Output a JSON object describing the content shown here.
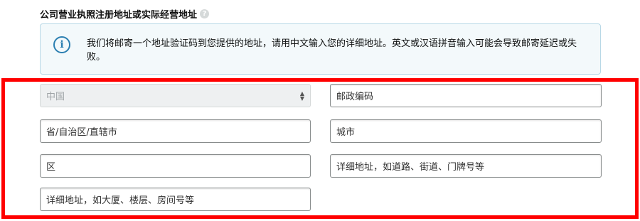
{
  "section": {
    "title": "公司营业执照注册地址或实际经营地址",
    "help_icon": "question-circle-icon"
  },
  "info": {
    "icon": "info-circle-icon",
    "icon_glyph": "i",
    "message": "我们将邮寄一个地址验证码到您提供的地址，请用中文输入您的详细地址。英文或汉语拼音输入可能会导致邮寄延迟或失败。"
  },
  "address_form": {
    "country_select": {
      "value": "中国",
      "disabled": true
    },
    "postal_code": {
      "placeholder": "邮政编码"
    },
    "province": {
      "placeholder": "省/自治区/直辖市"
    },
    "city": {
      "placeholder": "城市"
    },
    "district": {
      "placeholder": "区"
    },
    "street_address": {
      "placeholder": "详细地址，如道路、街道、门牌号等"
    },
    "building_address": {
      "placeholder": "详细地址，如大厦、楼层、房间号等"
    }
  },
  "colors": {
    "highlight_frame": "#ff0000",
    "info_border": "#b8d8e6",
    "info_icon": "#2b7fb1"
  }
}
